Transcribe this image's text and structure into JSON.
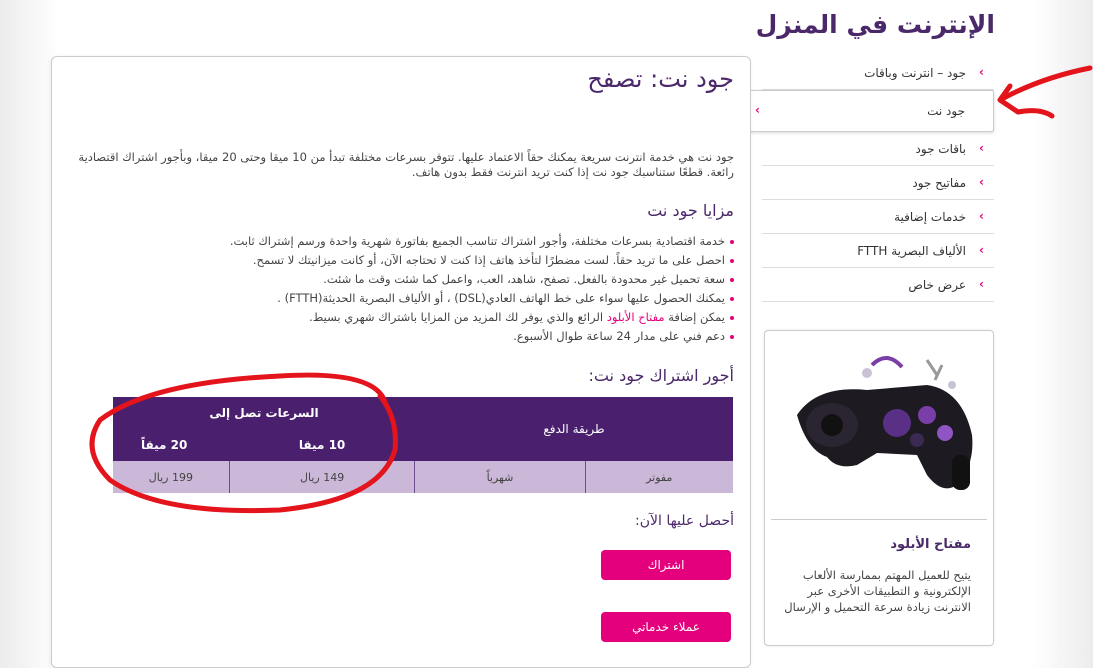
{
  "site": {
    "title": "الإنترنت في المنزل"
  },
  "sidebar": {
    "items": [
      {
        "label": "جود – انترنت وباقات",
        "active": false
      },
      {
        "label": "جود نت",
        "active": true
      },
      {
        "label": "باقات جود",
        "active": false
      },
      {
        "label": "مفاتيح جود",
        "active": false
      },
      {
        "label": "خدمات إضافية",
        "active": false
      },
      {
        "label": "الألياف البصرية FTTH",
        "active": false
      },
      {
        "label": "عرض خاص",
        "active": false
      }
    ],
    "chevron": "›",
    "promo": {
      "title": "مفتاح الأبلود",
      "description": "يتيح للعميل المهتم بممارسة الألعاب الإلكترونية و التطبيقات الأخرى عبر الانترنت زيادة سرعة التحميل و الإرسال",
      "image_icon": "game-controller-icon"
    }
  },
  "main": {
    "title": "جود نت: تصفح",
    "intro": "جود نت هي خدمة انترنت سريعة يمكنك حقاً الاعتماد عليها. تتوفر بسرعات مختلفة تبدأ من 10 ميقا وحتى 20 ميقا، وبأجور اشتراك اقتصادية رائعة. قطعًا ستناسبك جود نت إذا كنت تريد انترنت فقط بدون هاتف.",
    "features_title": "مزايا جود نت",
    "features": [
      "خدمة اقتصادية بسرعات مختلفة، وأجور اشتراك تناسب الجميع بفاتورة شهرية واحدة ورسم إشتراك ثابت.",
      "احصل على ما تريد حقاً. لست مضطرًا لتأخذ هاتف إذا كنت لا تحتاجه الآن، أو كانت ميزانيتك لا تسمح.",
      "سعة تحميل غير محدودة بالفعل. تصفح، شاهد، العب، واعمل كما شئت وقت ما شئت.",
      "يمكنك الحصول عليها سواء على خط الهاتف العادي(DSL) ، أو الألياف البصرية الحديثة(FTTH) ."
    ],
    "feature_addon": {
      "before": "يمكن إضافة ",
      "link": "مفتاح الأبلود",
      "after": " الرائع والذي يوفر لك المزيد من المزايا باشتراك شهري بسيط."
    },
    "feature_last": "دعم فني على مدار 24 ساعة طوال الأسبوع.",
    "pricing_title": "أجور اشتراك جود نت:",
    "pricing": {
      "payment_header": "طريقة الدفع",
      "speeds_header": "السرعات تصل إلى",
      "speed_cols": [
        "10 ميقا",
        "20 ميقاً"
      ],
      "row": {
        "billing": "مفوتر",
        "period": "شهرياً",
        "prices": [
          "149 ريال",
          "199 ريال"
        ]
      }
    },
    "cta_title": "أحصل عليها الآن:",
    "subscribe_label": "اشتراك",
    "customers_label": "عملاء خدماتي"
  },
  "colors": {
    "brand_purple": "#4a2869",
    "accent_pink": "#e4007c",
    "table_header": "#4a1f6e",
    "table_row": "#cbb8d8",
    "annotation_red": "#e3141b"
  }
}
